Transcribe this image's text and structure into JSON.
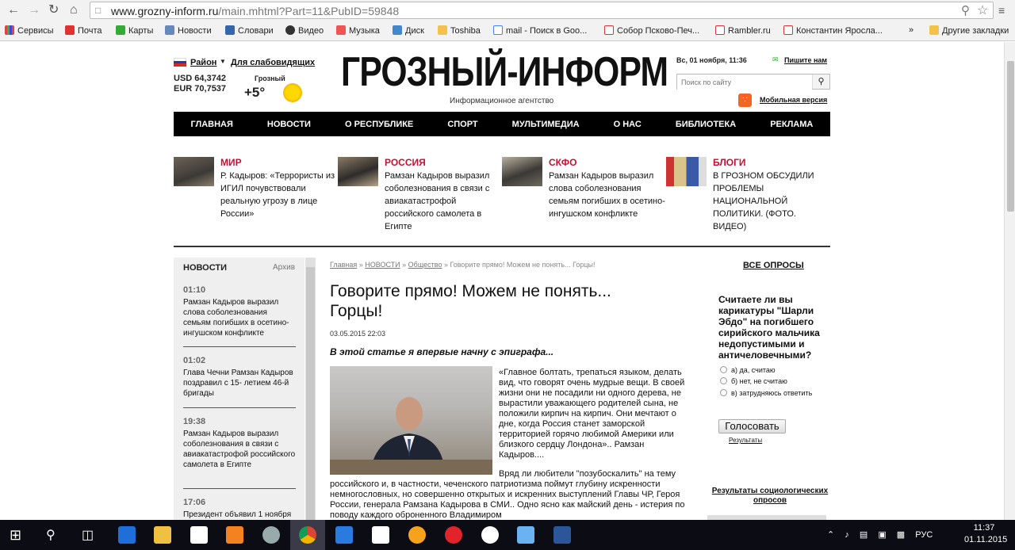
{
  "browser": {
    "url_host": "www.grozny-inform.ru",
    "url_path": "/main.mhtml?Part=11&PubID=59848",
    "bookmarks": [
      "Сервисы",
      "Почта",
      "Карты",
      "Новости",
      "Словари",
      "Видео",
      "Музыка",
      "Диск",
      "Toshiba",
      "mail - Поиск в Goo...",
      "Собор Псково-Печ...",
      "Rambler.ru",
      "Константин Яросла..."
    ],
    "more": "»",
    "other_bookmarks": "Другие закладки"
  },
  "header": {
    "region_label": "Район",
    "accessibility_link": "Для слабовидящих",
    "usd": "USD 64,3742",
    "eur": "EUR 70,7537",
    "weather_city": "Грозный",
    "temperature": "+5°",
    "logo": "ГРОЗНЫЙ-ИНФОРМ",
    "agency": "Информационное агентство",
    "datetime": "Вс, 01 ноября, 11:36",
    "write_us": "Пишите нам",
    "search_placeholder": "Поиск по сайту",
    "mobile_link": "Мобильная версия"
  },
  "menu": [
    "ГЛАВНАЯ",
    "НОВОСТИ",
    "О РЕСПУБЛИКЕ",
    "СПОРТ",
    "МУЛЬТИМЕДИА",
    "О НАС",
    "БИБЛИОТЕКА",
    "РЕКЛАМА"
  ],
  "teasers": [
    {
      "category": "МИР",
      "text": "Р. Кадыров: «Террористы из ИГИЛ почувствовали реальную угрозу в лице России»"
    },
    {
      "category": "РОССИЯ",
      "text": "Рамзан Кадыров выразил соболезнования в связи с авиакатастрофой российского самолета в Египте"
    },
    {
      "category": "СКФО",
      "text": "Рамзан Кадыров выразил слова соболезнования семьям погибших в осетино- ингушском конфликте"
    },
    {
      "category": "БЛОГИ",
      "text": "В ГРОЗНОМ ОБСУДИЛИ ПРОБЛЕМЫ НАЦИОНАЛЬНОЙ ПОЛИТИКИ. (ФОТО. ВИДЕО)"
    }
  ],
  "news": {
    "title": "НОВОСТИ",
    "archive": "Архив",
    "items": [
      {
        "time": "01:10",
        "text": "Рамзан Кадыров выразил слова соболезнования семьям погибших в осетино-ингушском конфликте"
      },
      {
        "time": "01:02",
        "text": "Глава Чечни Рамзан Кадыров поздравил с 15- летием 46-й бригады"
      },
      {
        "time": "19:38",
        "text": "Рамзан Кадыров выразил соболезнования в связи с авиакатастрофой российского самолета в Египте"
      },
      {
        "time": "17:06",
        "text": "Президент объявил 1 ноября"
      }
    ]
  },
  "article": {
    "crumbs": [
      "Главная",
      "НОВОСТИ",
      "Общество"
    ],
    "crumb_current": "Говорите прямо! Можем не понять... Горцы!",
    "title": "Говорите прямо! Можем не понять... Горцы!",
    "date": "03.05.2015 22:03",
    "lead": "В этой статье я впервые начну с эпиграфа...",
    "quote": "«Главное болтать, трепаться языком, делать вид, что говорят очень мудрые вещи. В своей жизни они не посадили ни одного дерева, не вырастили уважающего родителей сына, не положили кирпич на кирпич. Они мечтают о дне, когда Россия станет заморской территорией горячо любимой Америки или близкого сердцу Лондона».. Рамзан Кадыров....",
    "paragraph": "Вряд ли любители \"позубоскалить\" на тему российского и, в частности, чеченского патриотизма поймут глубину искренности немногословных, но совершенно открытых и искренних выступлений Главы ЧР, Героя России, генерала Рамзана Кадырова в СМИ.. Одно ясно как майский день - истерия по поводу каждого оброненного Владимиром"
  },
  "poll": {
    "all_polls": "ВСЕ ОПРОСЫ",
    "question": "Считаете ли вы карикатуры \"Шарли Эбдо\" на погибшего сирийского мальчика недопустимыми и античеловечными?",
    "options": [
      "а) да, считаю",
      "б) нет, не считаю",
      "в) затрудняюсь ответить"
    ],
    "vote": "Голосовать",
    "results": "Результаты",
    "sociology": "Результаты социологических опросов"
  },
  "taskbar": {
    "lang": "РУС",
    "time": "11:37",
    "date": "01.11.2015"
  }
}
